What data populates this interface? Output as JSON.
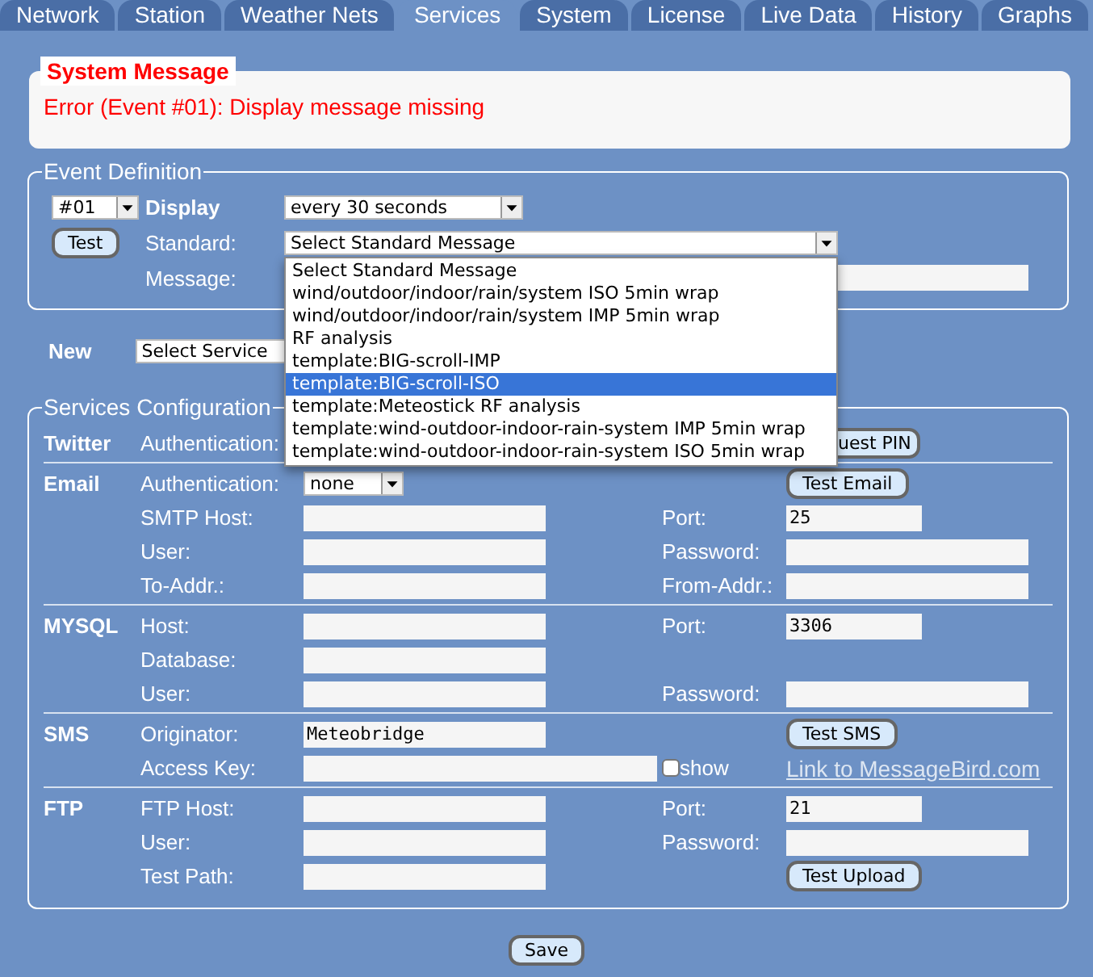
{
  "tabs": [
    {
      "label": "Network",
      "selected": false
    },
    {
      "label": "Station",
      "selected": false
    },
    {
      "label": "Weather Nets",
      "selected": false
    },
    {
      "label": "Services",
      "selected": true
    },
    {
      "label": "System",
      "selected": false
    },
    {
      "label": "License",
      "selected": false
    },
    {
      "label": "Live Data",
      "selected": false
    },
    {
      "label": "History",
      "selected": false
    },
    {
      "label": "Graphs",
      "selected": false
    }
  ],
  "system_message": {
    "title": "System Message",
    "text": "Error (Event #01): Display message missing"
  },
  "event_definition": {
    "title": "Event Definition",
    "event_select": "#01",
    "display_label": "Display",
    "display_select": "every 30 seconds",
    "test_button": "Test",
    "standard_label": "Standard:",
    "standard_select": "Select Standard Message",
    "message_label": "Message:",
    "dropdown": [
      {
        "label": "Select Standard Message",
        "selected": false
      },
      {
        "label": "wind/outdoor/indoor/rain/system ISO 5min wrap",
        "selected": false
      },
      {
        "label": "wind/outdoor/indoor/rain/system IMP 5min wrap",
        "selected": false
      },
      {
        "label": "RF analysis",
        "selected": false
      },
      {
        "label": "template:BIG-scroll-IMP",
        "selected": false
      },
      {
        "label": "template:BIG-scroll-ISO",
        "selected": true
      },
      {
        "label": "template:Meteostick RF analysis",
        "selected": false
      },
      {
        "label": "template:wind-outdoor-indoor-rain-system IMP 5min wrap",
        "selected": false
      },
      {
        "label": "template:wind-outdoor-indoor-rain-system ISO 5min wrap",
        "selected": false
      }
    ]
  },
  "new_service": {
    "label": "New",
    "select": "Select Service"
  },
  "services_configuration": {
    "title": "Services Configuration",
    "sections": [
      {
        "name": "Twitter",
        "rows": [
          {
            "label": "Authentication:",
            "right_control": {
              "kind": "button",
              "label": "uest PIN",
              "clipped": true
            }
          }
        ]
      },
      {
        "name": "Email",
        "rows": [
          {
            "label": "Authentication:",
            "control": {
              "kind": "select",
              "value": "none"
            },
            "right_control": {
              "kind": "button",
              "label": "Test Email"
            }
          },
          {
            "label": "SMTP Host:",
            "control": {
              "kind": "field"
            },
            "right_label": "Port:",
            "right_control": {
              "kind": "short_field",
              "value": "25"
            }
          },
          {
            "label": "User:",
            "control": {
              "kind": "field"
            },
            "right_label": "Password:",
            "right_control": {
              "kind": "field"
            }
          },
          {
            "label": "To-Addr.:",
            "control": {
              "kind": "field"
            },
            "right_label": "From-Addr.:",
            "right_control": {
              "kind": "field"
            }
          }
        ]
      },
      {
        "name": "MYSQL",
        "rows": [
          {
            "label": "Host:",
            "control": {
              "kind": "field"
            },
            "right_label": "Port:",
            "right_control": {
              "kind": "short_field",
              "value": "3306"
            }
          },
          {
            "label": "Database:",
            "control": {
              "kind": "field"
            }
          },
          {
            "label": "User:",
            "control": {
              "kind": "field"
            },
            "right_label": "Password:",
            "right_control": {
              "kind": "field"
            }
          }
        ]
      },
      {
        "name": "SMS",
        "rows": [
          {
            "label": "Originator:",
            "control": {
              "kind": "field",
              "value": "Meteobridge"
            },
            "right_control": {
              "kind": "button",
              "label": "Test SMS"
            }
          },
          {
            "label": "Access Key:",
            "control": {
              "kind": "long_field"
            },
            "checkbox": {
              "label": "show",
              "checked": false
            },
            "right_control": {
              "kind": "link",
              "label": "Link to MessageBird.com"
            }
          }
        ]
      },
      {
        "name": "FTP",
        "rows": [
          {
            "label": "FTP Host:",
            "control": {
              "kind": "field"
            },
            "right_label": "Port:",
            "right_control": {
              "kind": "short_field",
              "value": "21"
            }
          },
          {
            "label": "User:",
            "control": {
              "kind": "field"
            },
            "right_label": "Password:",
            "right_control": {
              "kind": "field"
            }
          },
          {
            "label": "Test Path:",
            "control": {
              "kind": "field"
            },
            "right_control": {
              "kind": "button",
              "label": "Test Upload"
            }
          }
        ]
      }
    ]
  },
  "save_button": "Save"
}
